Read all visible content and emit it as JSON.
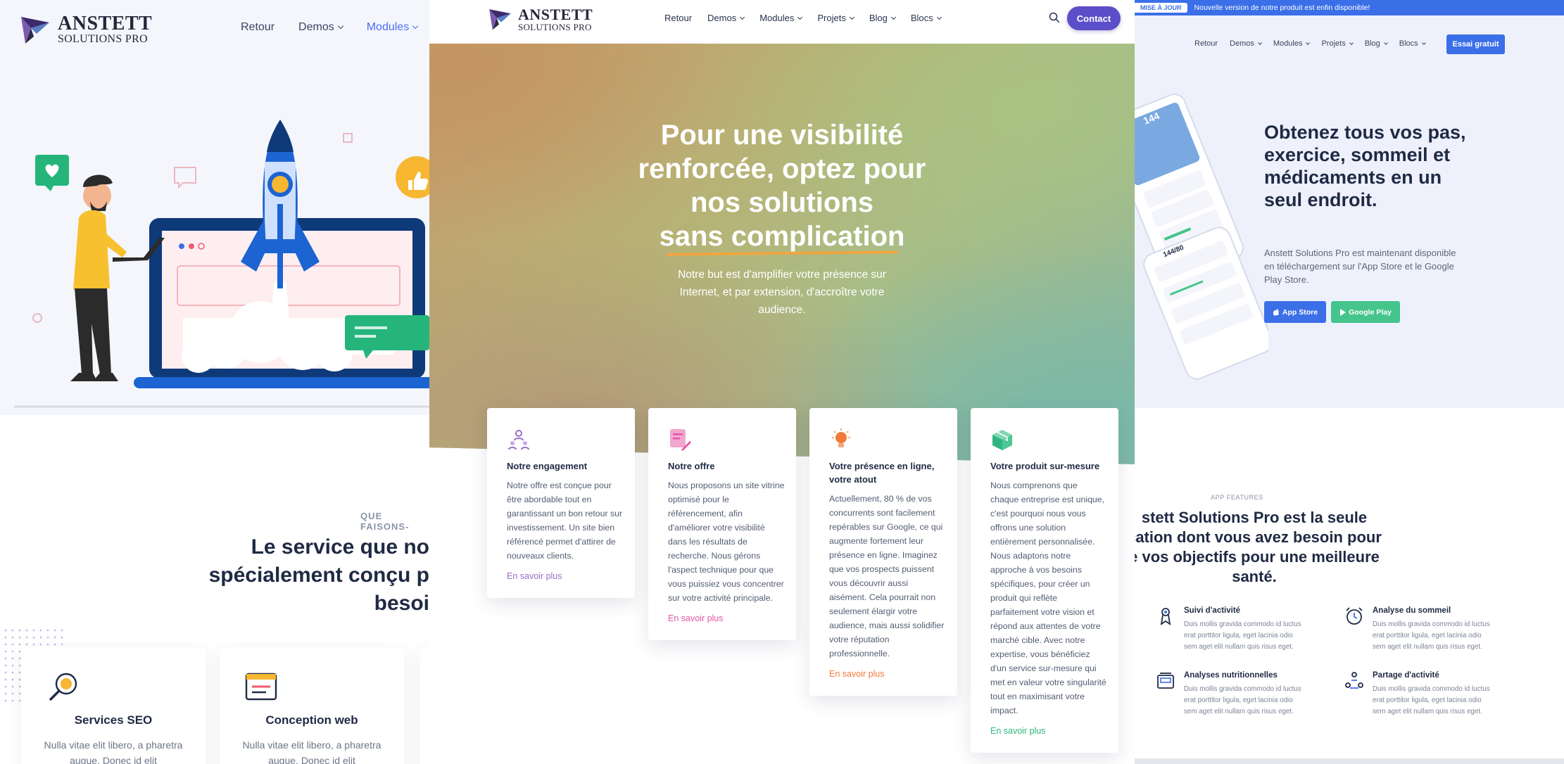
{
  "brand": {
    "name_main": "ANSTETT",
    "name_sub": "SOLUTIONS PRO"
  },
  "panel1": {
    "nav": [
      {
        "label": "Retour",
        "dropdown": false,
        "accent": false
      },
      {
        "label": "Demos",
        "dropdown": true,
        "accent": false
      },
      {
        "label": "Modules",
        "dropdown": true,
        "accent": true
      }
    ],
    "eyebrow": "QUE FAISONS-",
    "headline_lines": [
      "Le service que no",
      "spécialement conçu p",
      "besoi"
    ],
    "services": [
      {
        "icon": "seo-magnifier-icon",
        "title": "Services SEO",
        "desc": "Nulla vitae elit libero, a pharetra augue. Donec id elit"
      },
      {
        "icon": "web-design-icon",
        "title": "Conception web",
        "desc": "Nulla vitae elit libero, a pharetra augue. Donec id elit"
      }
    ]
  },
  "panel2": {
    "nav": [
      {
        "label": "Retour",
        "dropdown": false
      },
      {
        "label": "Demos",
        "dropdown": true
      },
      {
        "label": "Modules",
        "dropdown": true
      },
      {
        "label": "Projets",
        "dropdown": true
      },
      {
        "label": "Blog",
        "dropdown": true
      },
      {
        "label": "Blocs",
        "dropdown": true
      }
    ],
    "contact_label": "Contact",
    "hero_lines": [
      "Pour une visibilité",
      "renforcée, optez pour",
      "nos solutions"
    ],
    "hero_underlined": "sans complication",
    "hero_sub": "Notre but est d'amplifier votre présence sur Internet, et par extension, d'accroître votre audience.",
    "cards": [
      {
        "icon": "team-engagement-icon",
        "color": "#9b6cc9",
        "title": "Notre engagement",
        "body": "Notre offre est conçue pour être abordable tout en garantissant un bon retour sur investissement. Un site bien référencé permet d'attirer de nouveaux clients.",
        "link": "En savoir plus"
      },
      {
        "icon": "document-edit-icon",
        "color": "#e356a8",
        "title": "Notre offre",
        "body": "Nous proposons un site vitrine optimisé pour le référencement, afin d'améliorer votre visibilité dans les résultats de recherche. Nous gérons l'aspect technique pour que vous puissiez vous concentrer sur votre activité principale.",
        "link": "En savoir plus"
      },
      {
        "icon": "lightbulb-icon",
        "color": "#f07a3a",
        "title": "Votre présence en ligne, votre atout",
        "body": "Actuellement, 80 % de vos concurrents sont facilement repérables sur Google, ce qui augmente fortement leur présence en ligne. Imaginez que vos prospects puissent vous découvrir aussi aisément. Cela pourrait non seulement élargir votre audience, mais aussi solidifier votre réputation professionnelle.",
        "link": "En savoir plus"
      },
      {
        "icon": "box-icon",
        "color": "#2fb67f",
        "title": "Votre produit sur-mesure",
        "body": "Nous comprenons que chaque entreprise est unique, c'est pourquoi nous vous offrons une solution entièrement personnalisée. Nous adaptons notre approche à vos besoins spécifiques, pour créer un produit qui reflète parfaitement votre vision et répond aux attentes de votre marché cible. Avec notre expertise, vous bénéficiez d'un service sur-mesure qui met en valeur votre singularité tout en maximisant votre impact.",
        "link": "En savoir plus"
      }
    ]
  },
  "panel3": {
    "badge": "MISE À JOUR",
    "banner_text": "Nouvelle version de notre produit est enfin disponible!",
    "nav": [
      {
        "label": "Retour",
        "dropdown": false
      },
      {
        "label": "Demos",
        "dropdown": true
      },
      {
        "label": "Modules",
        "dropdown": true
      },
      {
        "label": "Projets",
        "dropdown": true
      },
      {
        "label": "Blog",
        "dropdown": true
      },
      {
        "label": "Blocs",
        "dropdown": true
      }
    ],
    "trial_label": "Essai gratuit",
    "hero_title": "Obtenez tous vos pas, exercice, sommeil et médicaments en un seul endroit.",
    "hero_text": "Anstett Solutions Pro est maintenant disponible en téléchargement sur l'App Store et le Google Play Store.",
    "app_store": "App Store",
    "google_play": "Google Play",
    "app_store_color": "#3b6fe8",
    "google_play_color": "#45c48b",
    "phone_stats": [
      "144",
      "144/80"
    ],
    "eyebrow": "APP FEATURES",
    "features_title_lines": [
      "stett Solutions Pro est la seule",
      "cation dont vous avez besoin pour",
      "e vos objectifs pour une meilleure",
      "santé."
    ],
    "features": [
      {
        "icon": "activity-tracking-icon",
        "title": "Suivi d'activité",
        "desc": "Duis mollis gravida commodo id luctus erat porttitor ligula, eget lacinia odio sem aget elit nullam quis risus eget."
      },
      {
        "icon": "sleep-alarm-icon",
        "title": "Analyse du sommeil",
        "desc": "Duis mollis gravida commodo id luctus erat porttitor ligula, eget lacinia odio sem aget elit nullam quis risus eget."
      },
      {
        "icon": "nutrition-scale-icon",
        "title": "Analyses nutritionnelles",
        "desc": "Duis mollis gravida commodo id luctus erat porttitor ligula, eget lacinia odio sem aget elit nullam quis risus eget."
      },
      {
        "icon": "share-activity-icon",
        "title": "Partage d'activité",
        "desc": "Duis mollis gravida commodo id luctus erat porttitor ligula, eget lacinia odio sem aget elit nullam quis risus eget."
      }
    ]
  }
}
